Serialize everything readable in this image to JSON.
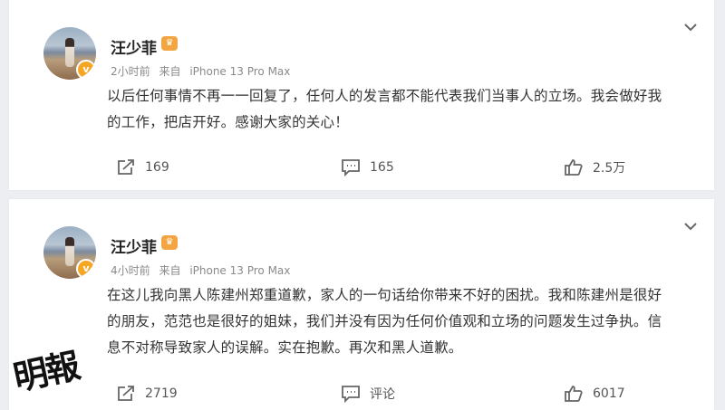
{
  "posts": [
    {
      "author": "汪少菲",
      "vip_badge": "v",
      "time": "2小时前",
      "source_prefix": "来自",
      "device": "iPhone 13 Pro Max",
      "text": "以后任何事情不再一一回复了，任何人的发言都不能代表我们当事人的立场。我会做好我的工作，把店开好。感谢大家的关心！",
      "reposts": "169",
      "comments": "165",
      "likes": "2.5万"
    },
    {
      "author": "汪少菲",
      "vip_badge": "v",
      "time": "4小时前",
      "source_prefix": "来自",
      "device": "iPhone 13 Pro Max",
      "text": "在这儿我向黑人陈建州郑重道歉，家人的一句话给你带来不好的困扰。我和陈建州是很好的朋友，范范也是很好的姐妹，我们并没有因为任何价值观和立场的问题发生过争执。信息不对称导致家人的误解。实在抱歉。再次和黑人道歉。",
      "reposts": "2719",
      "comments": "评论",
      "likes": "6017"
    }
  ],
  "watermark": "明報",
  "colors": {
    "background": "#eceef2",
    "vip": "#f2a541",
    "verified": "#f5a623"
  },
  "icons": [
    "chevron-down-icon",
    "repost-icon",
    "comment-icon",
    "like-icon"
  ]
}
